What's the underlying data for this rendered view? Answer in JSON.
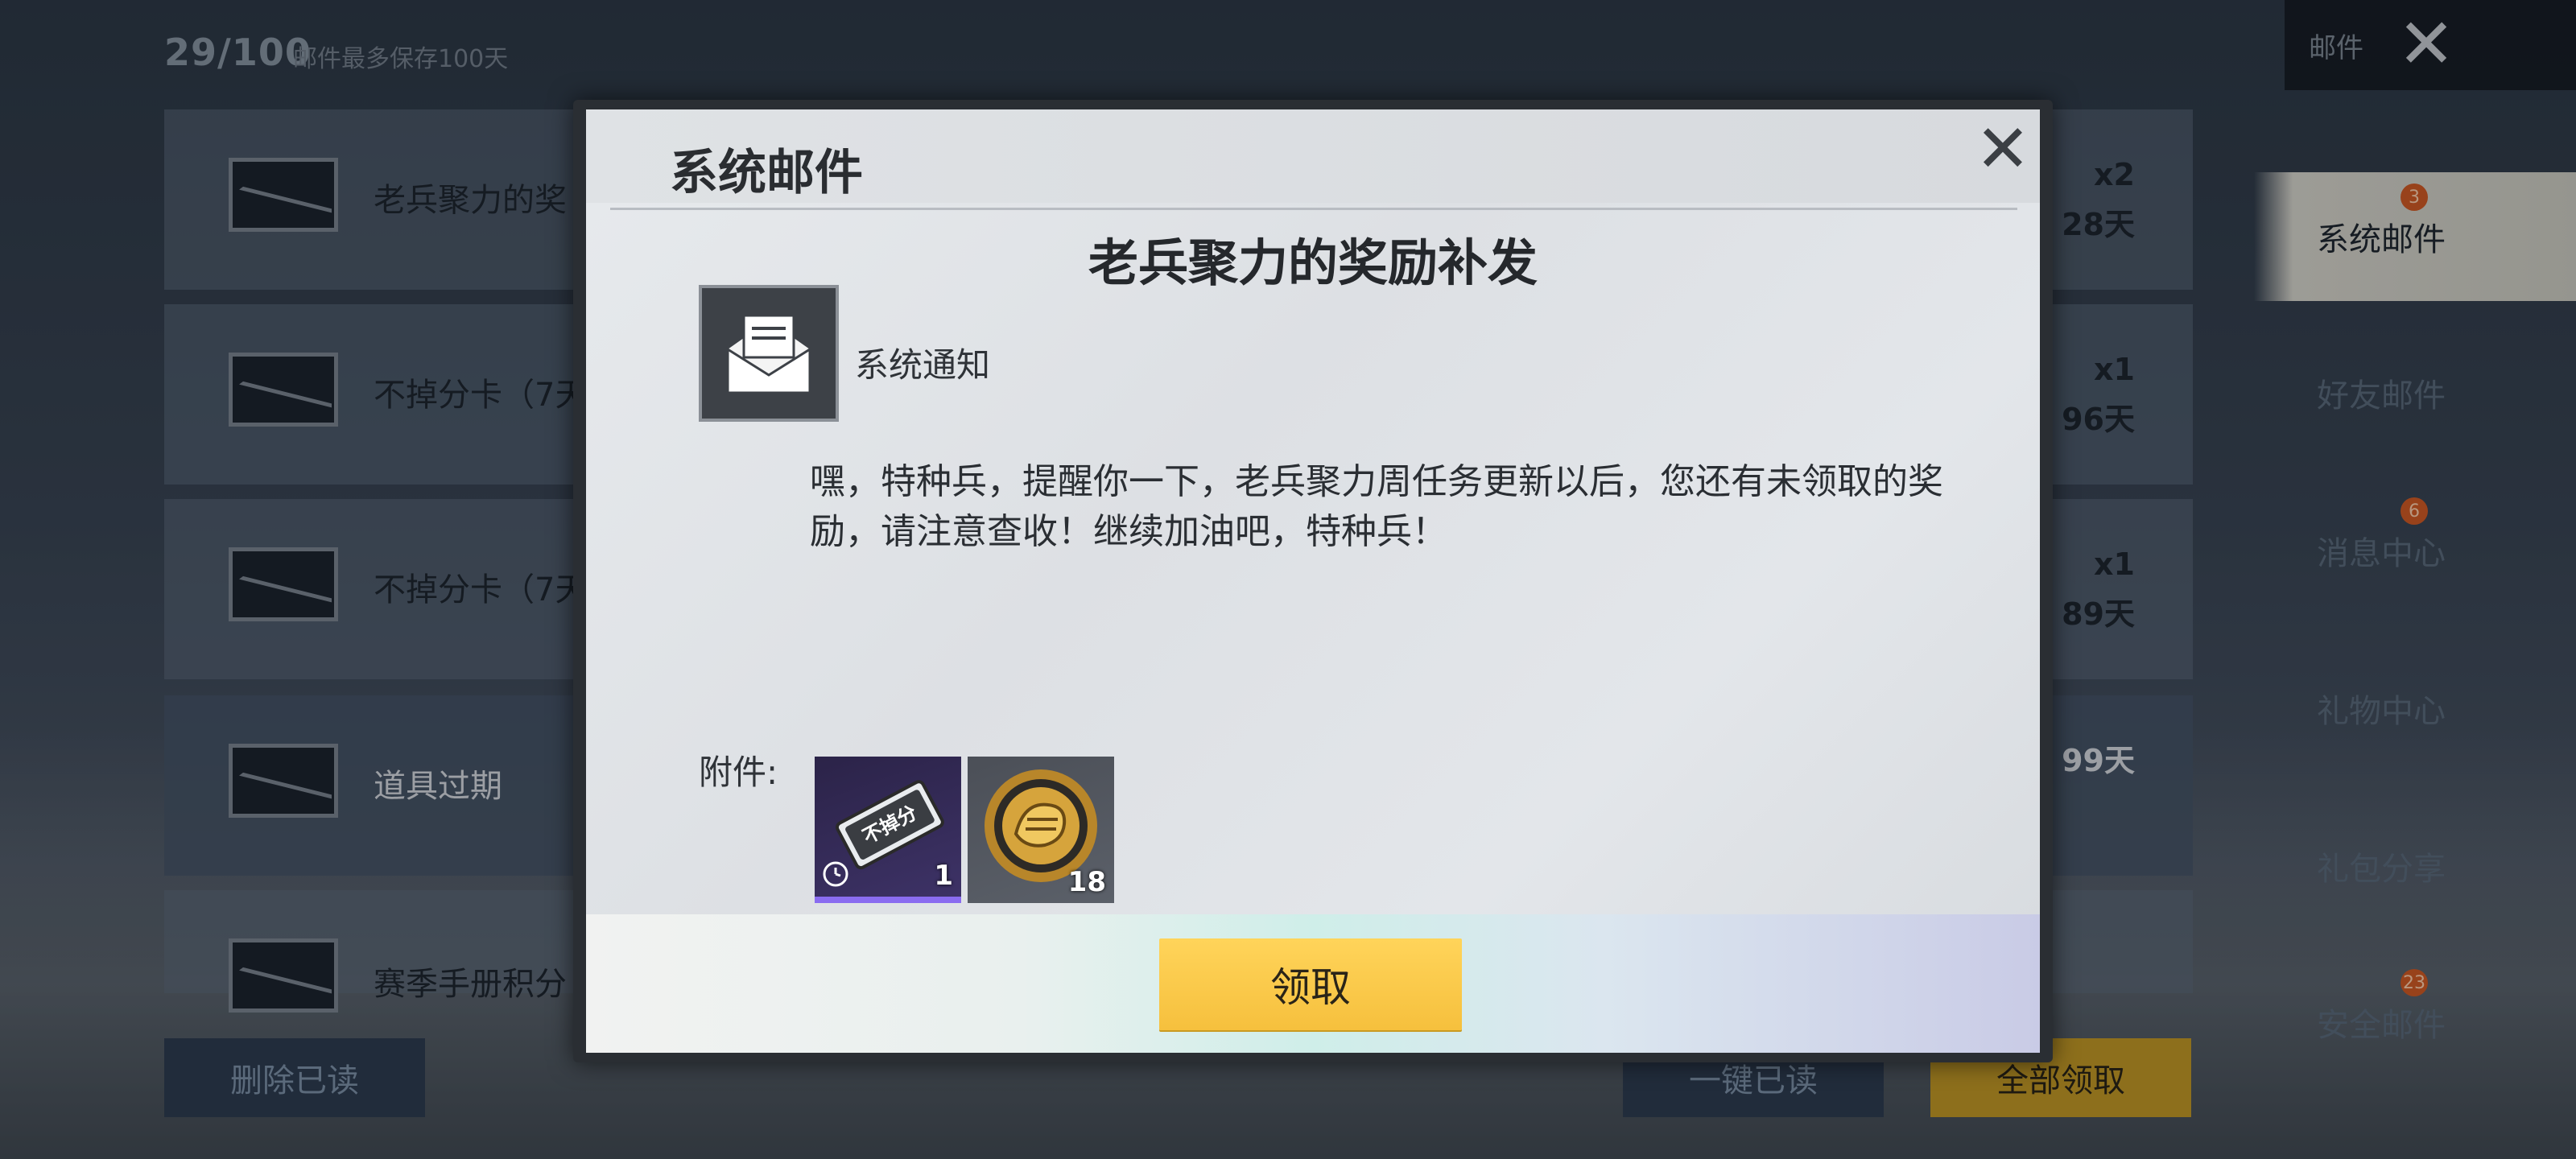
{
  "background": {
    "mail_count": "29/100",
    "mail_count_note": "邮件最多保存100天",
    "mail_list": [
      {
        "title": "老兵聚力的奖",
        "right_top": "x2",
        "right_bottom": "28天"
      },
      {
        "title": "不掉分卡（7天",
        "right_top": "x1",
        "right_bottom": "96天"
      },
      {
        "title": "不掉分卡（7天",
        "right_top": "x1",
        "right_bottom": "89天"
      },
      {
        "title": "道具过期",
        "right_top": "",
        "right_bottom": "99天"
      },
      {
        "title": "赛季手册积分",
        "right_top": "",
        "right_bottom": ""
      }
    ],
    "delete_read_label": "删除已读",
    "mark_all_read_label": "一键已读",
    "claim_all_label": "全部领取"
  },
  "sidebar": {
    "header_label": "邮件",
    "items": [
      {
        "label": "系统邮件",
        "badge": "3",
        "active": true
      },
      {
        "label": "好友邮件",
        "badge": ""
      },
      {
        "label": "消息中心",
        "badge": "6"
      },
      {
        "label": "礼物中心",
        "badge": ""
      },
      {
        "label": "礼包分享",
        "badge": ""
      },
      {
        "label": "安全邮件",
        "badge": "23"
      }
    ]
  },
  "modal": {
    "title": "系统邮件",
    "subject": "老兵聚力的奖励补发",
    "sender": "系统通知",
    "body": "嘿，特种兵，提醒你一下，老兵聚力周任务更新以后，您还有未领取的奖励，请注意查收！继续加油吧，特种兵！",
    "attachment_label": "附件:",
    "attachments": [
      {
        "icon": "no-rank-loss-card-icon",
        "card_text": "不掉分",
        "quantity": "1"
      },
      {
        "icon": "veteran-badge-icon",
        "quantity": "18"
      }
    ],
    "claim_label": "领取"
  },
  "colors": {
    "claim_button": "#f6c03d",
    "badge": "#d35c26",
    "modal_frame": "#2a2e33"
  }
}
